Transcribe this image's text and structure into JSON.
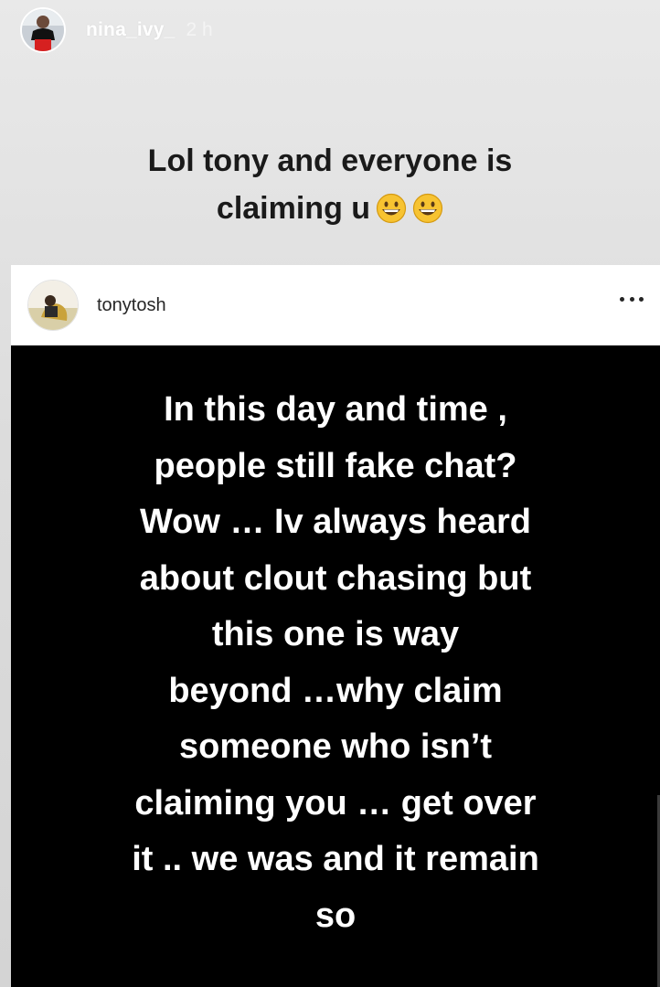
{
  "story": {
    "username": "nina_ivy_",
    "timestamp": "2 h",
    "caption_lines": [
      "Lol tony and everyone is",
      "claiming u"
    ],
    "caption_emojis": [
      "grinning-face",
      "grinning-face"
    ]
  },
  "post": {
    "username": "tonytosh",
    "more_icon": "more-horizontal-icon",
    "text_lines": [
      "In this day and time ,",
      "people still fake chat?",
      "Wow … Iv always heard",
      "about clout chasing but",
      "this one is way",
      "beyond …why claim",
      "someone who isn’t",
      "claiming you … get over",
      "it .. we was and it remain",
      "so"
    ]
  },
  "colors": {
    "story_bg": "#dcdcdc",
    "post_body_bg": "#000000",
    "post_header_bg": "#ffffff",
    "emoji_yellow": "#f7c331"
  }
}
